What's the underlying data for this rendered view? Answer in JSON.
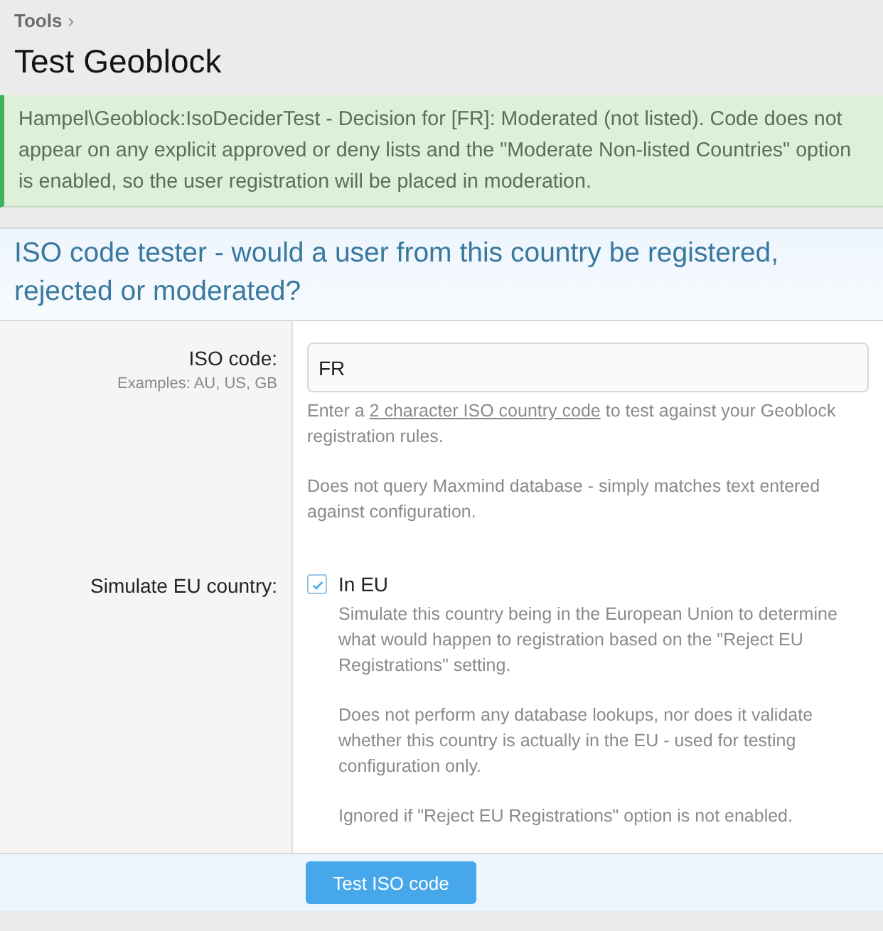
{
  "breadcrumb": [
    {
      "label": "Tools",
      "separator": "›"
    }
  ],
  "title": "Test Geoblock",
  "alert": {
    "kind": "success",
    "text": "Hampel\\Geoblock:IsoDeciderTest - Decision for [FR]: Moderated (not listed). Code does not appear on any explicit approved or deny lists and the \"Moderate Non-listed Countries\" option is enabled, so the user registration will be placed in moderation."
  },
  "form": {
    "heading": "ISO code tester - would a user from this country be registered, rejected or moderated?",
    "rows": [
      {
        "kind": "text",
        "label": "ISO code:",
        "hint": "Examples: AU, US, GB",
        "value": "FR",
        "explain": [
          {
            "before": "Enter a ",
            "link": "2 character ISO country code",
            "after": " to test against your Geoblock registration rules."
          },
          {
            "before": "Does not query Maxmind database - simply matches text entered against configuration."
          }
        ]
      },
      {
        "kind": "checkbox",
        "label": "Simulate EU country:",
        "option": "In EU",
        "checked": true,
        "explain": [
          {
            "before": "Simulate this country being in the European Union to determine what would happen to registration based on the \"Reject EU Registrations\" setting."
          },
          {
            "before": "Does not perform any database lookups, nor does it validate whether this country is actually in the EU - used for testing configuration only."
          },
          {
            "before": "Ignored if \"Reject EU Registrations\" option is not enabled."
          }
        ]
      }
    ],
    "submit": "Test ISO code"
  }
}
